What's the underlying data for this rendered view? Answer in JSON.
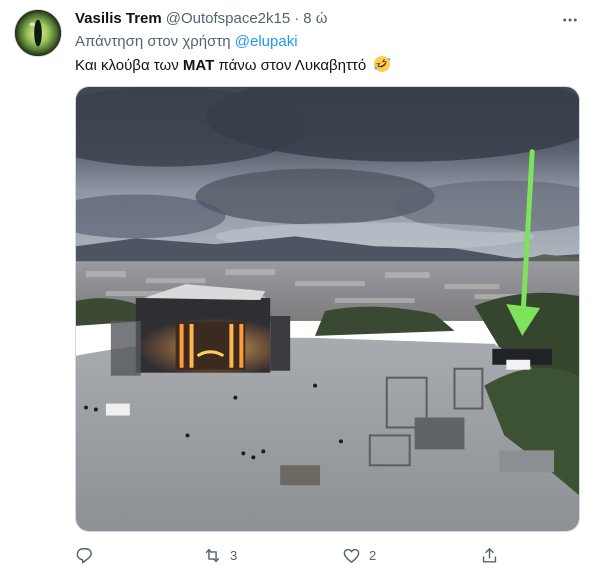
{
  "tweet": {
    "author_name": "Vasilis Trem",
    "author_handle": "@Outofspace2k15",
    "separator": "·",
    "time": "8 ώ",
    "reply_prefix": "Απάντηση στον χρήστη",
    "reply_to": "@elupaki",
    "text_before": "Και κλούβα των",
    "text_bold": "MAT",
    "text_after": "πάνω στον Λυκαβηττό",
    "emoji": "rolling-on-floor-laughing-emoji"
  },
  "actions": {
    "reply_count": "",
    "retweet_count": "3",
    "like_count": "2"
  },
  "icons": {
    "more": "more-dots-icon",
    "reply": "reply-icon",
    "retweet": "retweet-icon",
    "like": "heart-icon",
    "share": "share-icon"
  },
  "colors": {
    "link": "#1d9bf0",
    "secondary_text": "#536471",
    "primary_text": "#0f1419",
    "arrow_green": "#7ee35c"
  }
}
